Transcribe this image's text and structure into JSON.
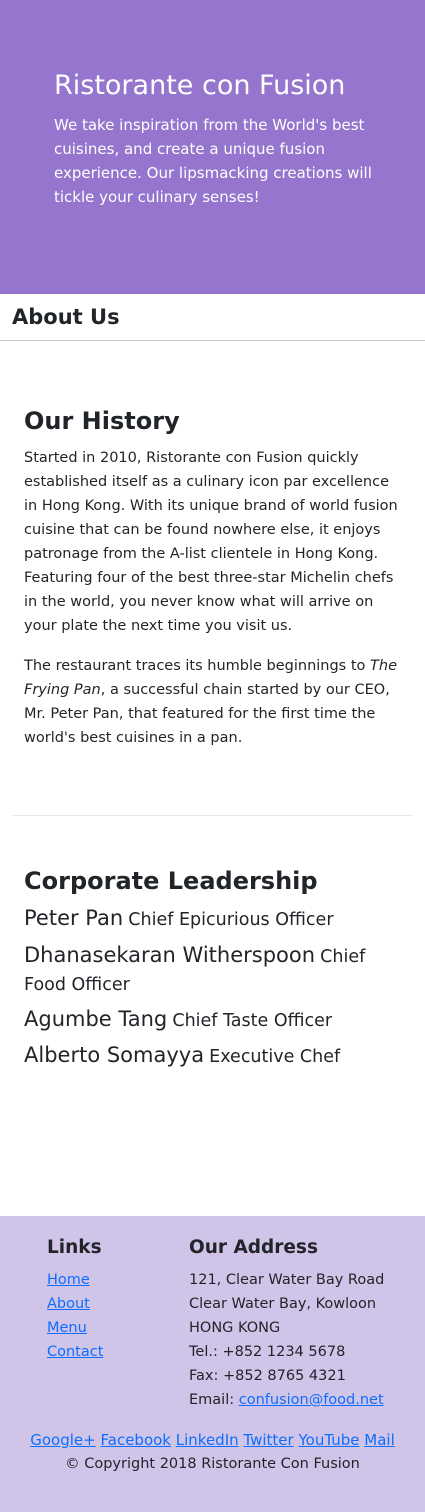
{
  "jumbotron": {
    "title": "Ristorante con Fusion",
    "text": "We take inspiration from the World's best cuisines, and create a unique fusion experience. Our lipsmacking creations will tickle your culinary senses!",
    "bg_color": "#9575cd"
  },
  "about": {
    "heading": "About Us"
  },
  "history": {
    "title": "Our History",
    "p1": "Started in 2010, Ristorante con Fusion quickly established itself as a culinary icon par excellence in Hong Kong. With its unique brand of world fusion cuisine that can be found nowhere else, it enjoys patronage from the A-list clientele in Hong Kong. Featuring four of the best three-star Michelin chefs in the world, you never know what will arrive on your plate the next time you visit us.",
    "p2_before": "The restaurant traces its humble beginnings to ",
    "p2_em": "The Frying Pan",
    "p2_after": ", a successful chain started by our CEO, Mr. Peter Pan, that featured for the first time the world's best cuisines in a pan."
  },
  "leadership": {
    "title": "Corporate Leadership",
    "leaders": [
      {
        "name": "Peter Pan",
        "role": "Chief Epicurious Officer"
      },
      {
        "name": "Dhanasekaran Witherspoon",
        "role": "Chief Food Officer"
      },
      {
        "name": "Agumbe Tang",
        "role": "Chief Taste Officer"
      },
      {
        "name": "Alberto Somayya",
        "role": "Executive Chef"
      }
    ]
  },
  "footer": {
    "bg_color": "#d1c4e9",
    "links_title": "Links",
    "links": [
      "Home",
      "About",
      "Menu",
      "Contact"
    ],
    "address_title": "Our Address",
    "address_lines": [
      "121, Clear Water Bay Road",
      "Clear Water Bay, Kowloon",
      "HONG KONG"
    ],
    "tel": "Tel.: +852 1234 5678",
    "fax": "Fax: +852 8765 4321",
    "email_label": "Email: ",
    "email": "confusion@food.net",
    "social": [
      "Google+",
      "Facebook",
      "LinkedIn",
      "Twitter",
      "YouTube",
      "Mail"
    ],
    "copyright": "© Copyright 2018 Ristorante Con Fusion"
  }
}
